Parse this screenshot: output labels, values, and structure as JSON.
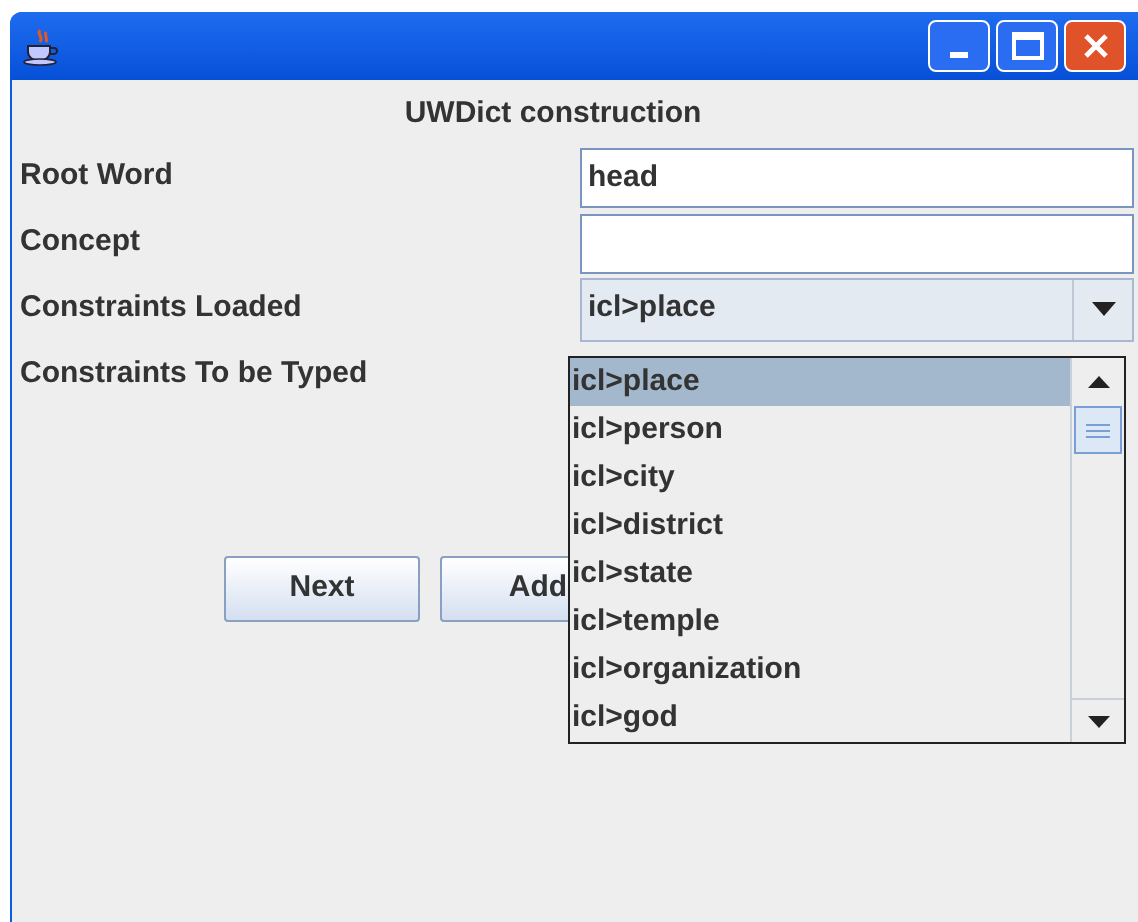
{
  "heading": "UWDict construction",
  "fields": [
    {
      "label": "Root Word",
      "value": "head"
    },
    {
      "label": "Concept"
    }
  ],
  "combo": {
    "label": "Constraints Loaded",
    "value": "icl>place",
    "expanded": true
  },
  "typed_label": "Constraints To be Typed",
  "options": [
    {
      "label": "icl>place",
      "selected": true
    },
    {
      "label": "icl>person",
      "selected": false
    },
    {
      "label": "icl>city",
      "selected": false
    },
    {
      "label": "icl>district",
      "selected": false
    },
    {
      "label": "icl>state",
      "selected": false
    },
    {
      "label": "icl>temple",
      "selected": false
    },
    {
      "label": "icl>organization",
      "selected": false
    },
    {
      "label": "icl>god",
      "selected": false
    }
  ],
  "buttons": [
    "Next",
    "Add"
  ]
}
